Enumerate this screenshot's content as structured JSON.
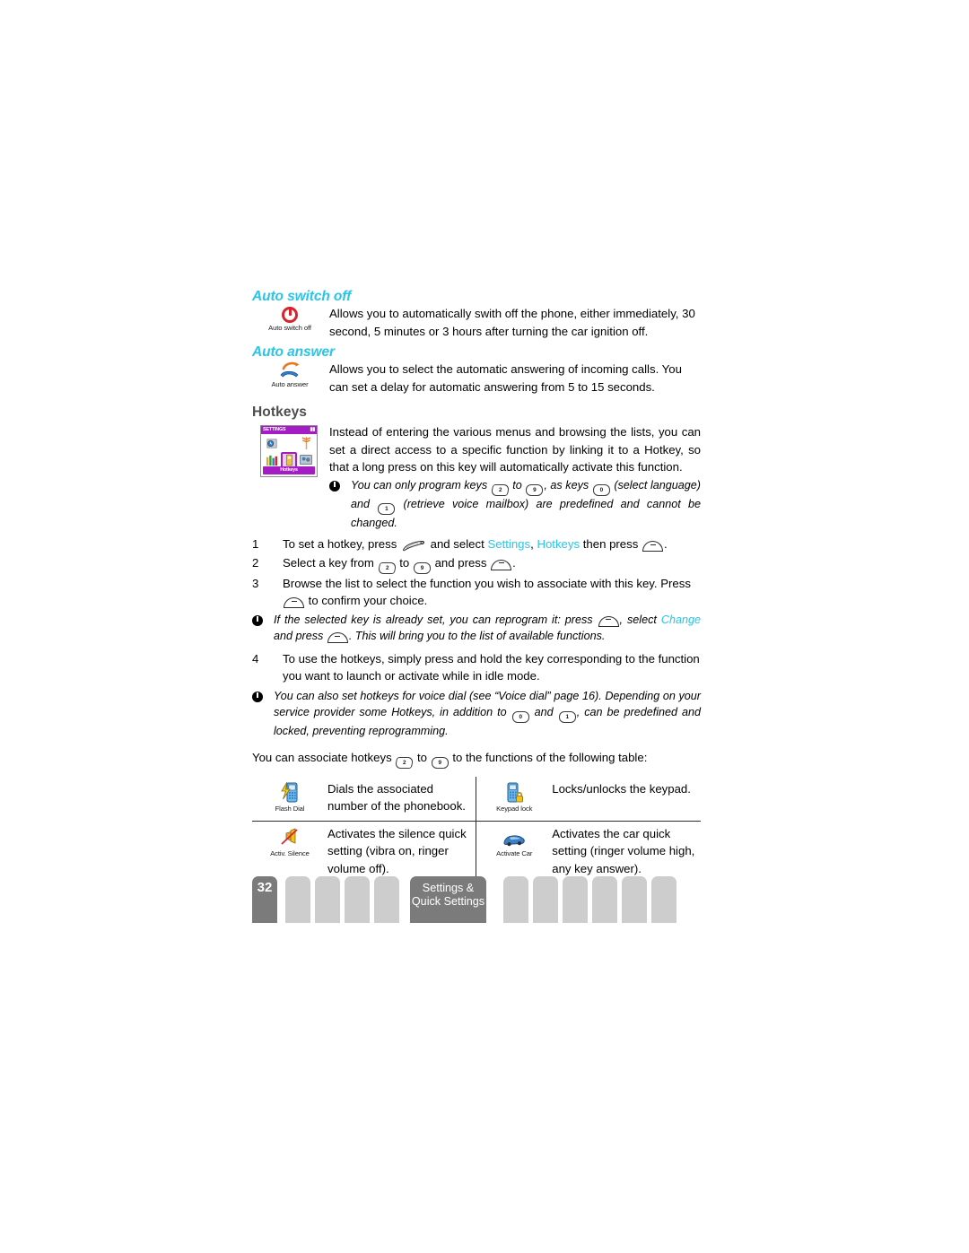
{
  "sections": {
    "auto_switch_off": {
      "heading": "Auto switch off",
      "icon_caption": "Auto switch off",
      "body": "Allows you to automatically swith off the phone, either immediately, 30 second, 5 minutes or 3 hours after turning the car ignition off."
    },
    "auto_answer": {
      "heading": "Auto answer",
      "icon_caption": "Auto answer",
      "body": "Allows you to select the automatic answering of incoming calls. You can set a delay for automatic answering from 5 to 15 seconds."
    },
    "hotkeys": {
      "heading": "Hotkeys",
      "screenshot": {
        "title": "SETTINGS",
        "footer_label": "Hotkeys"
      },
      "intro": "Instead of entering the various menus and browsing the lists, you can set a direct access to a specific function by linking it to a Hotkey, so that a long press on this key will automatically activate this function.",
      "note_1": {
        "part_a": "You can only program keys",
        "key_from": "2",
        "part_b": "to",
        "key_to": "9",
        "part_c": ", as keys",
        "key_zero": "0",
        "part_d": "(select language) and",
        "key_one": "1",
        "part_e": "(retrieve voice mailbox) are predefined and cannot be changed."
      },
      "steps": [
        {
          "num": "1",
          "part_a": "To set a hotkey, press",
          "part_b": "and select",
          "link_1": "Settings",
          "comma": ",",
          "link_2": "Hotkeys",
          "part_c": "then press",
          "part_d": "."
        },
        {
          "num": "2",
          "part_a": "Select a key from",
          "key_from": "2",
          "part_b": "to",
          "key_to": "9",
          "part_c": "and press",
          "part_d": "."
        },
        {
          "num": "3",
          "part_a": "Browse the list to select the function you wish to associate with this key. Press",
          "part_b": "to confirm your choice."
        },
        {
          "num": "4",
          "part_a": "To use the hotkeys, simply press and hold the key corresponding to the function you want to launch or activate while in idle mode."
        }
      ],
      "note_2": {
        "part_a": "If the selected key is already set, you can reprogram it: press",
        "part_b": ", select",
        "link_1": "Change",
        "part_c": "and press",
        "part_d": ". This will bring you to the list of available functions."
      },
      "note_3": {
        "part_a": "You can also set hotkeys for voice dial (see “Voice dial” page 16). Depending on your service provider some Hotkeys, in addition to",
        "key_zero": "0",
        "part_b": "and",
        "key_one": "1",
        "part_c": ", can be predefined and locked, preventing reprogramming."
      },
      "table_intro": {
        "part_a": "You can associate hotkeys",
        "key_from": "2",
        "part_b": "to",
        "key_to": "9",
        "part_c": "to the functions of the following table:"
      },
      "table": [
        {
          "left_icon_caption": "Flash Dial",
          "left_text": "Dials the associated number of the phonebook.",
          "right_icon_caption": "Keypad lock",
          "right_text": "Locks/unlocks the keypad."
        },
        {
          "left_icon_caption": "Activ. Silence",
          "left_text": "Activates the silence quick setting (vibra on, ringer volume off).",
          "right_icon_caption": "Activate Car",
          "right_text": "Activates the car quick setting (ringer volume high, any key answer)."
        }
      ]
    }
  },
  "footer": {
    "page_number": "32",
    "active_tab_line_1": "Settings &",
    "active_tab_line_2": "Quick Settings"
  },
  "colors": {
    "accent_cyan": "#29c5e8",
    "heading_gray": "#4d4d4d",
    "tab_active": "#7b7b7b",
    "tab_inactive": "#cdcdcd",
    "phone_purple": "#a41cc4",
    "power_red": "#d8232a"
  }
}
